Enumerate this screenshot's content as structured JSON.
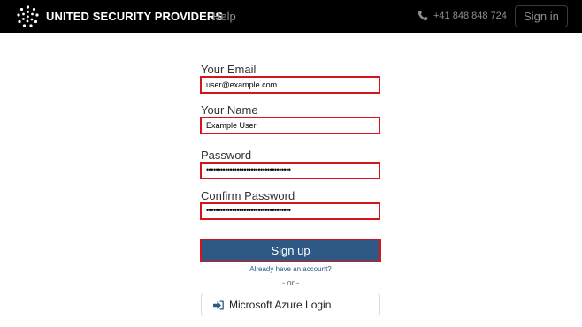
{
  "header": {
    "brand": "UNITED SECURITY PROVIDERS",
    "help_link": "Help",
    "phone": "+41 848 848 724",
    "signin_button": "Sign in",
    "phone_icon": "phone-icon",
    "logo_icon": "dots-logo"
  },
  "form": {
    "email_label": "Your Email",
    "email_value": "user@example.com",
    "name_label": "Your Name",
    "name_value": "Example User",
    "password_label": "Password",
    "password_value": "••••••••••••••••••••••••••••••••••••",
    "confirm_label": "Confirm Password",
    "confirm_value": "••••••••••••••••••••••••••••••••••••",
    "signup_button": "Sign up",
    "already_link": "Already have an account?",
    "or_text": "- or -",
    "azure_button": "Microsoft Azure Login",
    "azure_icon": "sign-in-arrow-icon"
  },
  "colors": {
    "topbar": "#000000",
    "primary_button": "#2d5984",
    "highlight_border": "#d6141c",
    "muted_text": "#8a8f96"
  }
}
